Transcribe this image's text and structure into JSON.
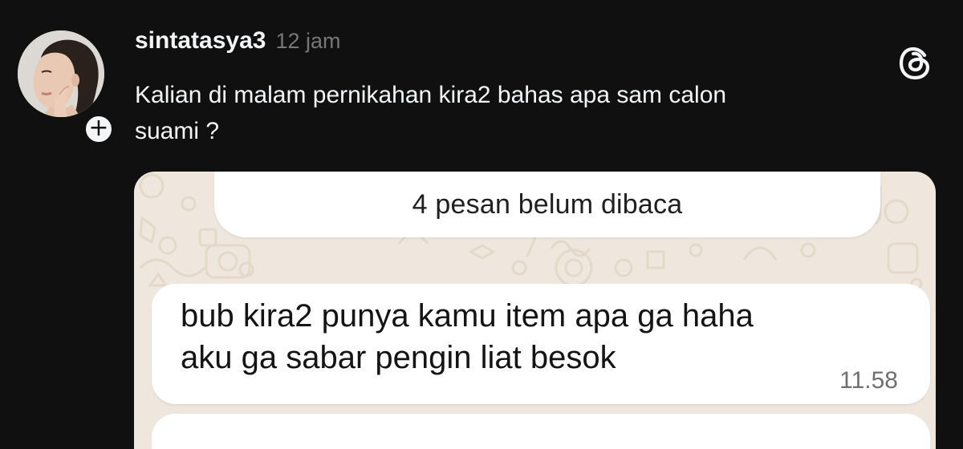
{
  "post": {
    "username": "sintatasya3",
    "timestamp": "12 jam",
    "caption": "Kalian di malam pernikahan kira2 bahas apa sam calon\nsuami ?",
    "follow_symbol": "+",
    "avatar_icon": "profile-photo",
    "app_icon": "threads-logo-icon"
  },
  "attachment": {
    "unread_banner": "4 pesan belum dibaca",
    "message": {
      "text": "bub kira2 punya kamu item apa ga haha\naku ga sabar pengin liat besok",
      "time": "11.58"
    }
  },
  "colors": {
    "background": "#101010",
    "primary_text": "#f3f5f7",
    "secondary_text": "#777777",
    "chat_wallpaper": "#efe7dd",
    "bubble": "#ffffff"
  }
}
